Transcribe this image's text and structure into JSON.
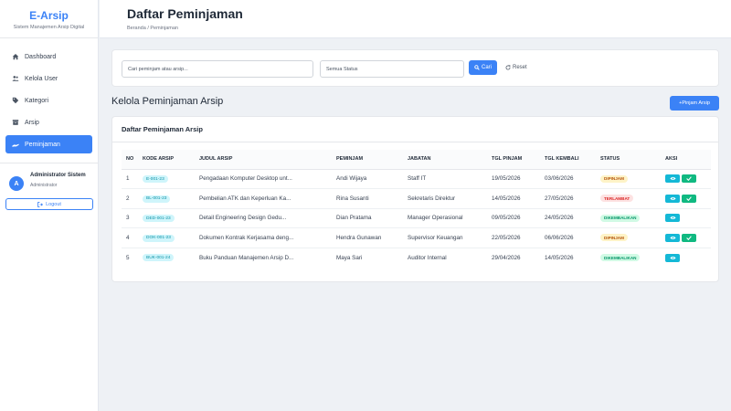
{
  "sidebar": {
    "brand_title": "E-Arsip",
    "brand_subtitle": "Sistem Manajemen Arsip Digital",
    "items": [
      {
        "label": "Dashboard",
        "icon": "home-icon"
      },
      {
        "label": "Kelola User",
        "icon": "users-icon"
      },
      {
        "label": "Kategori",
        "icon": "tag-icon"
      },
      {
        "label": "Arsip",
        "icon": "archive-icon"
      },
      {
        "label": "Peminjaman",
        "icon": "hand-icon",
        "active": true
      }
    ],
    "user": {
      "initial": "A",
      "name": "Administrator Sistem",
      "role": "Administrator",
      "logout_label": "Logout"
    }
  },
  "header": {
    "title": "Daftar Peminjaman",
    "breadcrumb": "Beranda / Peminjaman"
  },
  "filter": {
    "search_placeholder": "Cari peminjam atau arsip...",
    "status_value": "Semua Status",
    "search_button": "Cari",
    "reset_button": "Reset"
  },
  "section": {
    "title": "Kelola Peminjaman Arsip",
    "add_button": "+Pinjam Arsip"
  },
  "table": {
    "card_title": "Daftar Peminjaman Arsip",
    "columns": [
      "NO",
      "KODE ARSIP",
      "JUDUL ARSIP",
      "PEMINJAM",
      "JABATAN",
      "TGL PINJAM",
      "TGL KEMBALI",
      "STATUS",
      "AKSI"
    ],
    "rows": [
      {
        "no": "1",
        "kode": "E-001-23",
        "judul": "Pengadaan Komputer Desktop unt...",
        "peminjam": "Andi Wijaya",
        "jabatan": "Staff IT",
        "tgl_pinjam": "19/05/2026",
        "tgl_kembali": "03/06/2026",
        "status": "DIPINJAM",
        "status_type": "dipinjam"
      },
      {
        "no": "2",
        "kode": "BL-001-23",
        "judul": "Pembelian ATK dan Keperluan Ka...",
        "peminjam": "Rina Susanti",
        "jabatan": "Sekretaris Direktur",
        "tgl_pinjam": "14/05/2026",
        "tgl_kembali": "27/05/2026",
        "status": "TERLAMBAT",
        "status_type": "terlambat"
      },
      {
        "no": "3",
        "kode": "DED-001-23",
        "judul": "Detail Engineering Design Gedu...",
        "peminjam": "Dian Pratama",
        "jabatan": "Manager Operasional",
        "tgl_pinjam": "09/05/2026",
        "tgl_kembali": "24/05/2026",
        "status": "DIKEMBALIKAN",
        "status_type": "dikembalikan"
      },
      {
        "no": "4",
        "kode": "DOK-001-23",
        "judul": "Dokumen Kontrak Kerjasama deng...",
        "peminjam": "Hendra Gunawan",
        "jabatan": "Supervisor Keuangan",
        "tgl_pinjam": "22/05/2026",
        "tgl_kembali": "06/06/2026",
        "status": "DIPINJAM",
        "status_type": "dipinjam"
      },
      {
        "no": "5",
        "kode": "BUK-001-24",
        "judul": "Buku Panduan Manajemen Arsip D...",
        "peminjam": "Maya Sari",
        "jabatan": "Auditor Internal",
        "tgl_pinjam": "29/04/2026",
        "tgl_kembali": "14/05/2026",
        "status": "DIKEMBALIKAN",
        "status_type": "dikembalikan"
      }
    ]
  },
  "colors": {
    "accent": "#3b82f6",
    "info": "#14b8d6",
    "success": "#10b981"
  }
}
